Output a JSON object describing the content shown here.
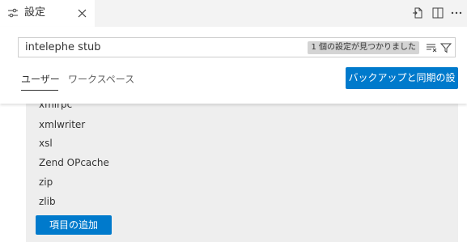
{
  "tab": {
    "label": "設定"
  },
  "search": {
    "value": "intelephe stub",
    "result_count": "1 個の設定が見つかりました"
  },
  "scopes": {
    "user": "ユーザー",
    "workspace": "ワークスペース"
  },
  "backup_button": "バックアップと同期の設定",
  "list": {
    "items": [
      "xmlrpc",
      "xmlwriter",
      "xsl",
      "Zend OPcache",
      "zip",
      "zlib"
    ],
    "add_button": "項目の追加"
  }
}
